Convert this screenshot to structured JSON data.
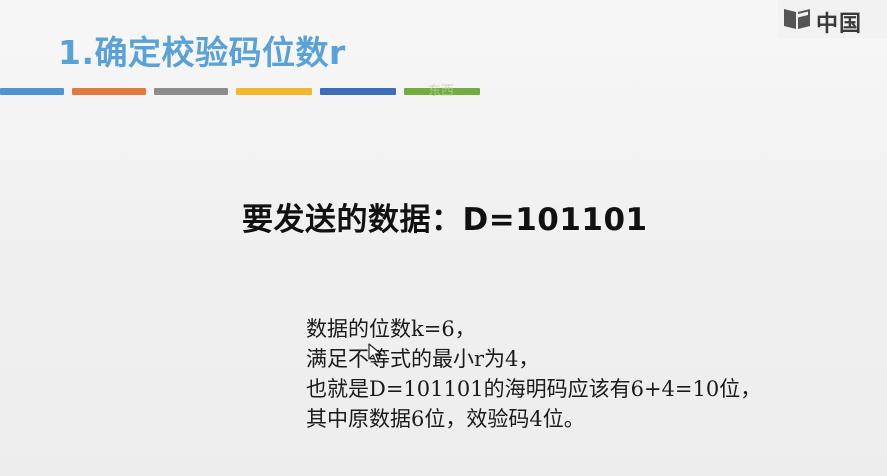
{
  "slide": {
    "title": "1.确定校验码位数r",
    "watermark": "东西",
    "color_bars": [
      {
        "color": "#4f93d0"
      },
      {
        "color": "#e07a3e"
      },
      {
        "color": "#8c8c8c"
      },
      {
        "color": "#f3b72c"
      },
      {
        "color": "#3d6db8"
      },
      {
        "color": "#6fae3e"
      }
    ],
    "headline": "要发送的数据：D=101101",
    "lines": [
      "数据的位数k=6，",
      "满足不等式的最小r为4，",
      "也就是D=101101的海明码应该有6+4=10位，",
      "其中原数据6位，效验码4位。"
    ]
  },
  "logo": {
    "text": "中国",
    "icon": "book-logo-icon"
  }
}
